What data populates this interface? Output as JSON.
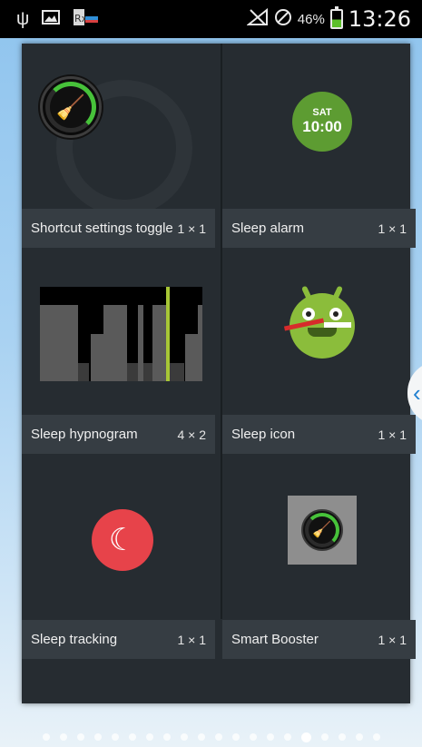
{
  "status_bar": {
    "icons": [
      "usb-icon",
      "image-icon",
      "rx-icon",
      "no-signal-icon",
      "blocked-icon",
      "battery-charging-icon"
    ],
    "battery_percent": "46%",
    "time": "13:26"
  },
  "widgets": [
    {
      "label": "Shortcut settings toggle",
      "size": "1 × 1",
      "icon": "booster-broom-icon"
    },
    {
      "label": "Sleep alarm",
      "size": "1 × 1",
      "icon": "alarm-badge",
      "day": "SAT",
      "time": "10:00"
    },
    {
      "label": "Sleep hypnogram",
      "size": "4 × 2",
      "icon": "hypnogram-chart"
    },
    {
      "label": "Sleep icon",
      "size": "1 × 1",
      "icon": "android-toothbrush-icon"
    },
    {
      "label": "Sleep tracking",
      "size": "1 × 1",
      "icon": "moon-icon"
    },
    {
      "label": "Smart Booster",
      "size": "1 × 1",
      "icon": "booster-broom-icon"
    }
  ],
  "page_indicator": {
    "count": 20,
    "active_index": 15
  },
  "colors": {
    "panel": "#262c31",
    "label_bar": "#363d43",
    "alarm_green": "#5d9c32",
    "moon_red": "#e7434a",
    "hypno_marker": "#a7c636"
  }
}
